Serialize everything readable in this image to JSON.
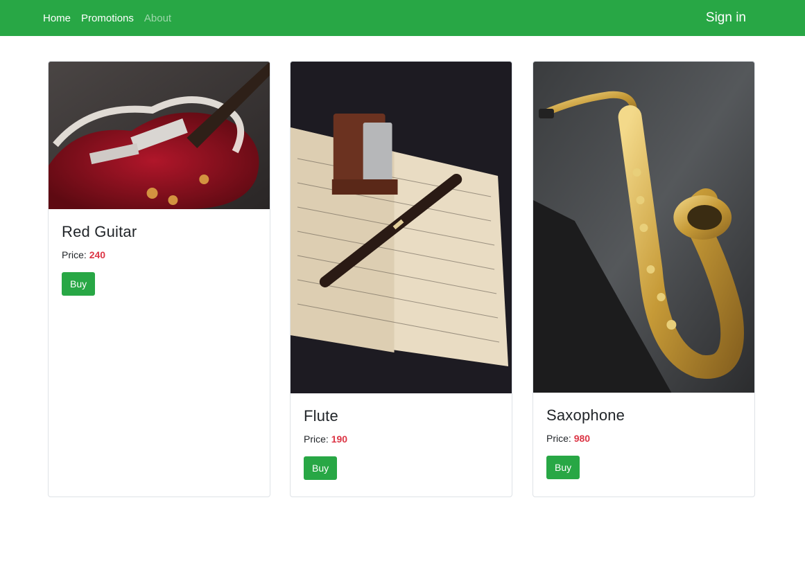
{
  "nav": {
    "links": [
      {
        "label": "Home"
      },
      {
        "label": "Promotions"
      },
      {
        "label": "About"
      }
    ],
    "signin_label": "Sign in"
  },
  "products": [
    {
      "title": "Red Guitar",
      "price_label": "Price:",
      "price": "240",
      "buy_label": "Buy",
      "image_icon": "electric-guitar-photo"
    },
    {
      "title": "Flute",
      "price_label": "Price:",
      "price": "190",
      "buy_label": "Buy",
      "image_icon": "flute-sheet-music-photo"
    },
    {
      "title": "Saxophone",
      "price_label": "Price:",
      "price": "980",
      "buy_label": "Buy",
      "image_icon": "saxophone-photo"
    }
  ],
  "colors": {
    "brand": "#28a745",
    "price": "#dc3545"
  }
}
